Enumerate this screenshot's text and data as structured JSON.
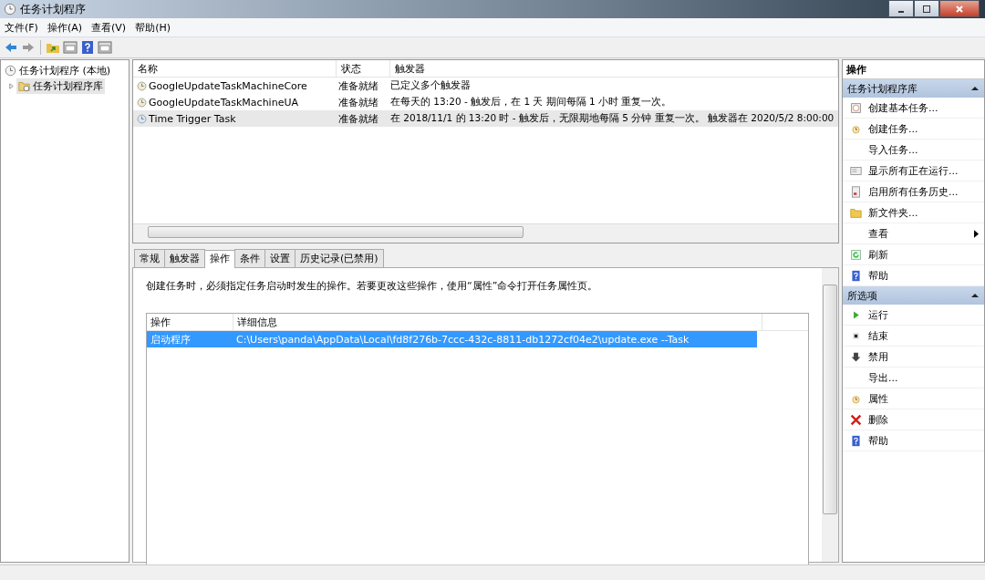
{
  "window": {
    "title": "任务计划程序"
  },
  "menu": [
    "文件(F)",
    "操作(A)",
    "查看(V)",
    "帮助(H)"
  ],
  "tree": {
    "label": "任务计划程序 (本地)",
    "selected": false,
    "children": [
      {
        "label": "任务计划程序库",
        "selected": true,
        "expanded": false
      }
    ]
  },
  "tasks": {
    "columns": [
      "名称",
      "状态",
      "触发器"
    ],
    "rows": [
      {
        "name": "GoogleUpdateTaskMachineCore",
        "status": "准备就绪",
        "trigger": "已定义多个触发器",
        "selected": false
      },
      {
        "name": "GoogleUpdateTaskMachineUA",
        "status": "准备就绪",
        "trigger": "在每天的 13:20 - 触发后，在 1 天 期间每隔 1 小时 重复一次。",
        "selected": false
      },
      {
        "name": "Time Trigger Task",
        "status": "准备就绪",
        "trigger": "在 2018/11/1 的 13:20 时 - 触发后，无限期地每隔 5 分钟 重复一次。 触发器在 2020/5/2 8:00:00",
        "selected": true
      }
    ]
  },
  "tabs": [
    {
      "label": "常规",
      "selected": false
    },
    {
      "label": "触发器",
      "selected": false
    },
    {
      "label": "操作",
      "selected": true
    },
    {
      "label": "条件",
      "selected": false
    },
    {
      "label": "设置",
      "selected": false
    },
    {
      "label": "历史记录(已禁用)",
      "selected": false
    }
  ],
  "description": "创建任务时，必须指定任务启动时发生的操作。若要更改这些操作，使用“属性”命令打开任务属性页。",
  "actions_table": {
    "columns": [
      "操作",
      "详细信息"
    ],
    "rows": [
      {
        "action": "启动程序",
        "details": "C:\\Users\\panda\\AppData\\Local\\fd8f276b-7ccc-432c-8811-db1272cf04e2\\update.exe --Task",
        "selected": true
      }
    ]
  },
  "actions_pane": {
    "title": "操作",
    "sections": [
      {
        "title": "任务计划程序库",
        "expanded": true,
        "items": [
          {
            "label": "创建基本任务...",
            "kind": "wizard",
            "submenu": false
          },
          {
            "label": "创建任务...",
            "kind": "clock",
            "submenu": false
          },
          {
            "label": "导入任务...",
            "kind": "plain",
            "submenu": false
          },
          {
            "label": "显示所有正在运行...",
            "kind": "list",
            "submenu": false
          },
          {
            "label": "启用所有任务历史...",
            "kind": "history",
            "submenu": false
          },
          {
            "label": "新文件夹...",
            "kind": "folder",
            "submenu": false
          },
          {
            "label": "查看",
            "kind": "plain",
            "submenu": true
          },
          {
            "label": "刷新",
            "kind": "refresh",
            "submenu": false
          },
          {
            "label": "帮助",
            "kind": "help",
            "submenu": false
          }
        ]
      },
      {
        "title": "所选项",
        "expanded": true,
        "items": [
          {
            "label": "运行",
            "kind": "play",
            "submenu": false
          },
          {
            "label": "结束",
            "kind": "stop",
            "submenu": false
          },
          {
            "label": "禁用",
            "kind": "down",
            "submenu": false
          },
          {
            "label": "导出...",
            "kind": "plain",
            "submenu": false
          },
          {
            "label": "属性",
            "kind": "clock",
            "submenu": false
          },
          {
            "label": "删除",
            "kind": "delete",
            "submenu": false
          },
          {
            "label": "帮助",
            "kind": "help",
            "submenu": false
          }
        ]
      }
    ]
  }
}
